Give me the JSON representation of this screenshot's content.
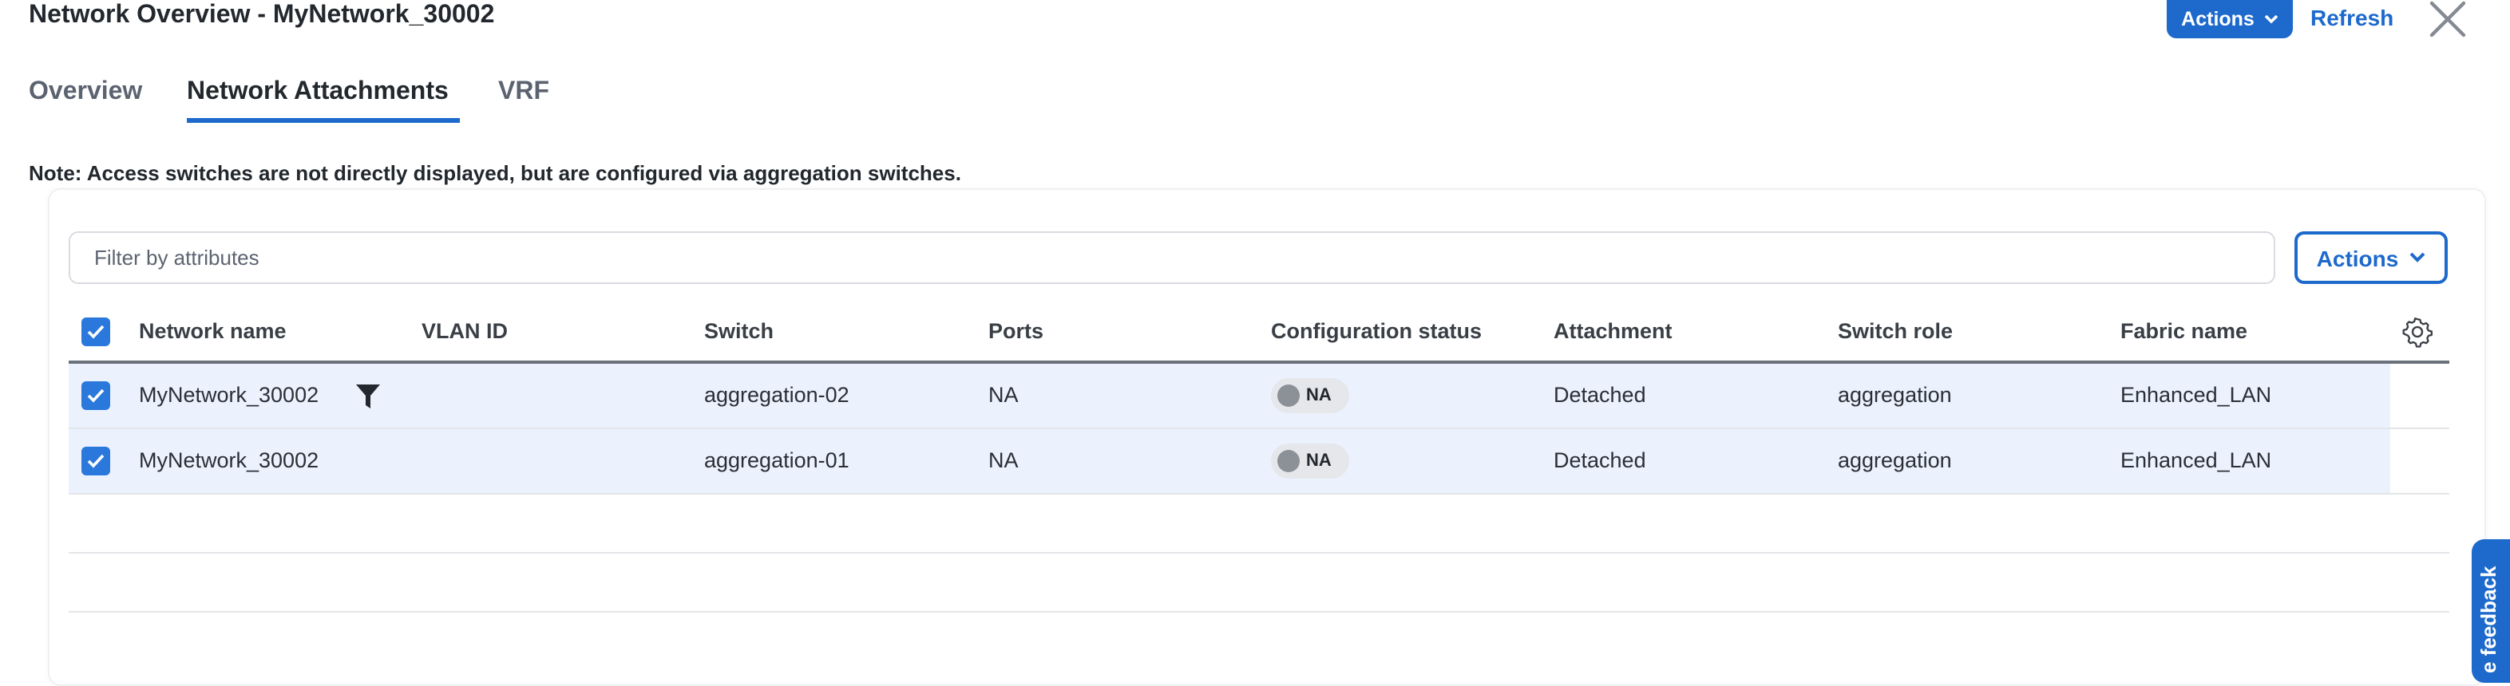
{
  "header": {
    "title": "Network Overview - MyNetwork_30002",
    "actions_label": "Actions",
    "refresh_label": "Refresh"
  },
  "tabs": [
    {
      "label": "Overview"
    },
    {
      "label": "Network Attachments",
      "active": true
    },
    {
      "label": "VRF"
    }
  ],
  "note": "Note: Access switches are not directly displayed, but are configured via aggregation switches.",
  "toolbar": {
    "filter_placeholder": "Filter by attributes",
    "actions_label": "Actions"
  },
  "table": {
    "columns": [
      "Network name",
      "VLAN ID",
      "Switch",
      "Ports",
      "Configuration status",
      "Attachment",
      "Switch role",
      "Fabric name"
    ],
    "rows": [
      {
        "network_name": "MyNetwork_30002",
        "vlan_id": "",
        "switch": "aggregation-02",
        "ports": "NA",
        "config_status": "NA",
        "attachment": "Detached",
        "switch_role": "aggregation",
        "fabric_name": "Enhanced_LAN",
        "checked": true
      },
      {
        "network_name": "MyNetwork_30002",
        "vlan_id": "",
        "switch": "aggregation-01",
        "ports": "NA",
        "config_status": "NA",
        "attachment": "Detached",
        "switch_role": "aggregation",
        "fabric_name": "Enhanced_LAN",
        "checked": true
      }
    ]
  },
  "feedback_label": "e feedback",
  "colors": {
    "primary": "#1d69cc",
    "row_selected": "#ebf2fe"
  }
}
